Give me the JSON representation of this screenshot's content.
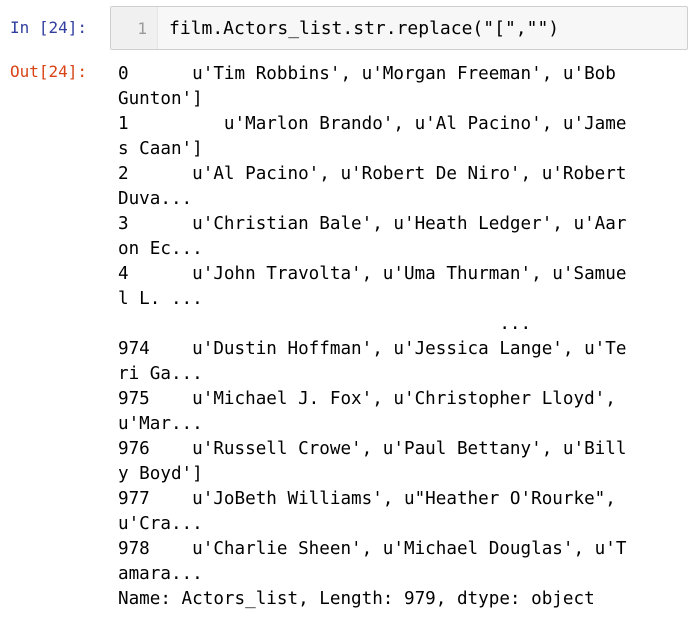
{
  "input_cell": {
    "prompt": "In [24]:",
    "line_number": "1",
    "code": "film.Actors_list.str.replace(\"[\",\"\")"
  },
  "output_cell": {
    "prompt": "Out[24]:",
    "lines": [
      "0      u'Tim Robbins', u'Morgan Freeman', u'Bob",
      "Gunton']",
      "1         u'Marlon Brando', u'Al Pacino', u'Jame",
      "s Caan']",
      "2      u'Al Pacino', u'Robert De Niro', u'Robert",
      "Duva...",
      "3      u'Christian Bale', u'Heath Ledger', u'Aar",
      "on Ec...",
      "4      u'John Travolta', u'Uma Thurman', u'Samue",
      "l L. ...",
      "                                    ...",
      "974    u'Dustin Hoffman', u'Jessica Lange', u'Te",
      "ri Ga...",
      "975    u'Michael J. Fox', u'Christopher Lloyd',",
      "u'Mar...",
      "976    u'Russell Crowe', u'Paul Bettany', u'Bill",
      "y Boyd']",
      "977    u'JoBeth Williams', u\"Heather O'Rourke\",",
      "u'Cra...",
      "978    u'Charlie Sheen', u'Michael Douglas', u'T",
      "amara...",
      "Name: Actors_list, Length: 979, dtype: object"
    ]
  }
}
